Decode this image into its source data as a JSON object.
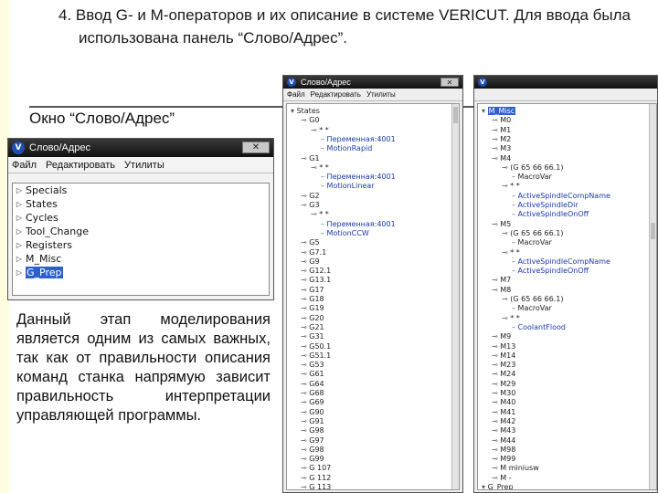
{
  "slide": {
    "title_line1": "4. Ввод G- и M-операторов и их описание в системе VERICUT. Для ввода была",
    "title_line2": "использована панель “Слово/Адрес”.",
    "window_label": "Окно “Слово/Адрес”",
    "body": "Данный этап моделирования является одним из самых важных, так как от правильности описания команд станка напрямую зависит правильность интерпретации управляющей программы."
  },
  "small_window": {
    "title": "Слово/Адрес",
    "menu": [
      "Файл",
      "Редактировать",
      "Утилиты"
    ],
    "items": [
      "Specials",
      "States",
      "Cycles",
      "Tool_Change",
      "Registers",
      "M_Misc",
      "G_Prep"
    ],
    "selected_index": 6
  },
  "left_window": {
    "title": "Слово/Адрес",
    "menu": [
      "Файл",
      "Редактировать",
      "Утилиты"
    ],
    "rows": [
      {
        "indent": 0,
        "label": "States",
        "blue": false
      },
      {
        "indent": 1,
        "label": "G0",
        "blue": false
      },
      {
        "indent": 2,
        "label": "* *",
        "blue": false
      },
      {
        "indent": 3,
        "label": "Переменная:4001",
        "blue": true
      },
      {
        "indent": 3,
        "label": "MotionRapid",
        "blue": true
      },
      {
        "indent": 1,
        "label": "G1",
        "blue": false
      },
      {
        "indent": 2,
        "label": "* *",
        "blue": false
      },
      {
        "indent": 3,
        "label": "Переменная:4001",
        "blue": true
      },
      {
        "indent": 3,
        "label": "MotionLinear",
        "blue": true
      },
      {
        "indent": 1,
        "label": "G2",
        "blue": false
      },
      {
        "indent": 1,
        "label": "G3",
        "blue": false
      },
      {
        "indent": 2,
        "label": "* *",
        "blue": false
      },
      {
        "indent": 3,
        "label": "Переменная:4001",
        "blue": true
      },
      {
        "indent": 3,
        "label": "MotionCCW",
        "blue": true
      },
      {
        "indent": 1,
        "label": "G5",
        "blue": false
      },
      {
        "indent": 1,
        "label": "G7.1",
        "blue": false
      },
      {
        "indent": 1,
        "label": "G9",
        "blue": false
      },
      {
        "indent": 1,
        "label": "G12.1",
        "blue": false
      },
      {
        "indent": 1,
        "label": "G13.1",
        "blue": false
      },
      {
        "indent": 1,
        "label": "G17",
        "blue": false
      },
      {
        "indent": 1,
        "label": "G18",
        "blue": false
      },
      {
        "indent": 1,
        "label": "G19",
        "blue": false
      },
      {
        "indent": 1,
        "label": "G20",
        "blue": false
      },
      {
        "indent": 1,
        "label": "G21",
        "blue": false
      },
      {
        "indent": 1,
        "label": "G31",
        "blue": false
      },
      {
        "indent": 1,
        "label": "G50.1",
        "blue": false
      },
      {
        "indent": 1,
        "label": "G51.1",
        "blue": false
      },
      {
        "indent": 1,
        "label": "G53",
        "blue": false
      },
      {
        "indent": 1,
        "label": "G61",
        "blue": false
      },
      {
        "indent": 1,
        "label": "G64",
        "blue": false
      },
      {
        "indent": 1,
        "label": "G68",
        "blue": false
      },
      {
        "indent": 1,
        "label": "G69",
        "blue": false
      },
      {
        "indent": 1,
        "label": "G90",
        "blue": false
      },
      {
        "indent": 1,
        "label": "G91",
        "blue": false
      },
      {
        "indent": 1,
        "label": "G98",
        "blue": false
      },
      {
        "indent": 1,
        "label": "G97",
        "blue": false
      },
      {
        "indent": 1,
        "label": "G98",
        "blue": false
      },
      {
        "indent": 1,
        "label": "G99",
        "blue": false
      },
      {
        "indent": 1,
        "label": "G 107",
        "blue": false
      },
      {
        "indent": 1,
        "label": "G 112",
        "blue": false
      },
      {
        "indent": 1,
        "label": "G 113",
        "blue": false
      }
    ]
  },
  "right_window": {
    "rows": [
      {
        "indent": 0,
        "label": "M_Misc",
        "blue": false,
        "sel": true
      },
      {
        "indent": 1,
        "label": "M0",
        "blue": false
      },
      {
        "indent": 1,
        "label": "M1",
        "blue": false
      },
      {
        "indent": 1,
        "label": "M2",
        "blue": false
      },
      {
        "indent": 1,
        "label": "M3",
        "blue": false
      },
      {
        "indent": 1,
        "label": "M4",
        "blue": false
      },
      {
        "indent": 2,
        "label": "(G 65 66 66.1)",
        "blue": false
      },
      {
        "indent": 3,
        "label": "MacroVar",
        "blue": false
      },
      {
        "indent": 2,
        "label": "* *",
        "blue": false
      },
      {
        "indent": 3,
        "label": "ActiveSpindleCompName",
        "blue": true
      },
      {
        "indent": 3,
        "label": "ActiveSpindleDir",
        "blue": true
      },
      {
        "indent": 3,
        "label": "ActiveSpindleOnOff",
        "blue": true
      },
      {
        "indent": 1,
        "label": "M5",
        "blue": false
      },
      {
        "indent": 2,
        "label": "(G 65 66 66.1)",
        "blue": false
      },
      {
        "indent": 3,
        "label": "MacroVar",
        "blue": false
      },
      {
        "indent": 2,
        "label": "* *",
        "blue": false
      },
      {
        "indent": 3,
        "label": "ActiveSpindleCompName",
        "blue": true
      },
      {
        "indent": 3,
        "label": "ActiveSpindleOnOff",
        "blue": true
      },
      {
        "indent": 1,
        "label": "M7",
        "blue": false
      },
      {
        "indent": 1,
        "label": "M8",
        "blue": false
      },
      {
        "indent": 2,
        "label": "(G 65 66 66.1)",
        "blue": false
      },
      {
        "indent": 3,
        "label": "MacroVar",
        "blue": false
      },
      {
        "indent": 2,
        "label": "* *",
        "blue": false
      },
      {
        "indent": 3,
        "label": "CoolantFlood",
        "blue": true
      },
      {
        "indent": 1,
        "label": "M9",
        "blue": false
      },
      {
        "indent": 1,
        "label": "M13",
        "blue": false
      },
      {
        "indent": 1,
        "label": "M14",
        "blue": false
      },
      {
        "indent": 1,
        "label": "M23",
        "blue": false
      },
      {
        "indent": 1,
        "label": "M24",
        "blue": false
      },
      {
        "indent": 1,
        "label": "M29",
        "blue": false
      },
      {
        "indent": 1,
        "label": "M30",
        "blue": false
      },
      {
        "indent": 1,
        "label": "M40",
        "blue": false
      },
      {
        "indent": 1,
        "label": "M41",
        "blue": false
      },
      {
        "indent": 1,
        "label": "M42",
        "blue": false
      },
      {
        "indent": 1,
        "label": "M43",
        "blue": false
      },
      {
        "indent": 1,
        "label": "M44",
        "blue": false
      },
      {
        "indent": 1,
        "label": "M98",
        "blue": false
      },
      {
        "indent": 1,
        "label": "M99",
        "blue": false
      },
      {
        "indent": 1,
        "label": "M miniusw",
        "blue": false
      },
      {
        "indent": 1,
        "label": "M -",
        "blue": false
      },
      {
        "indent": 0,
        "label": "G_Prep",
        "blue": false
      }
    ]
  }
}
